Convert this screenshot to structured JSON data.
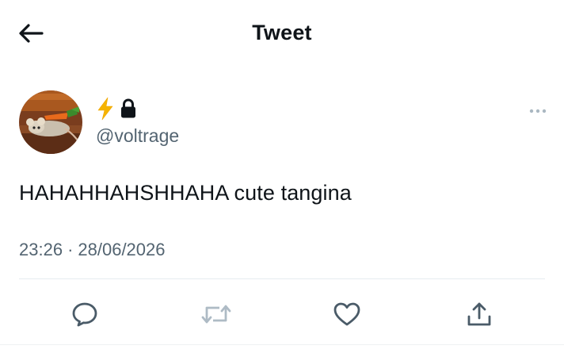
{
  "header": {
    "title": "Tweet"
  },
  "author": {
    "display_name_icons": [
      "lightning-bolt-emoji",
      "lock-icon"
    ],
    "handle": "@voltrage",
    "avatar": "avatar-image"
  },
  "tweet": {
    "text": "HAHAHHAHSHHAHA cute tangina",
    "time": "23:26",
    "separator": "·",
    "date": "28/06/2026"
  },
  "actions": {
    "icons": [
      "reply-icon",
      "retweet-icon",
      "like-icon",
      "share-icon"
    ]
  },
  "colors": {
    "text_primary": "#0f1419",
    "text_secondary": "#536471",
    "divider": "#e6ecf0",
    "bolt": "#f5b400"
  }
}
